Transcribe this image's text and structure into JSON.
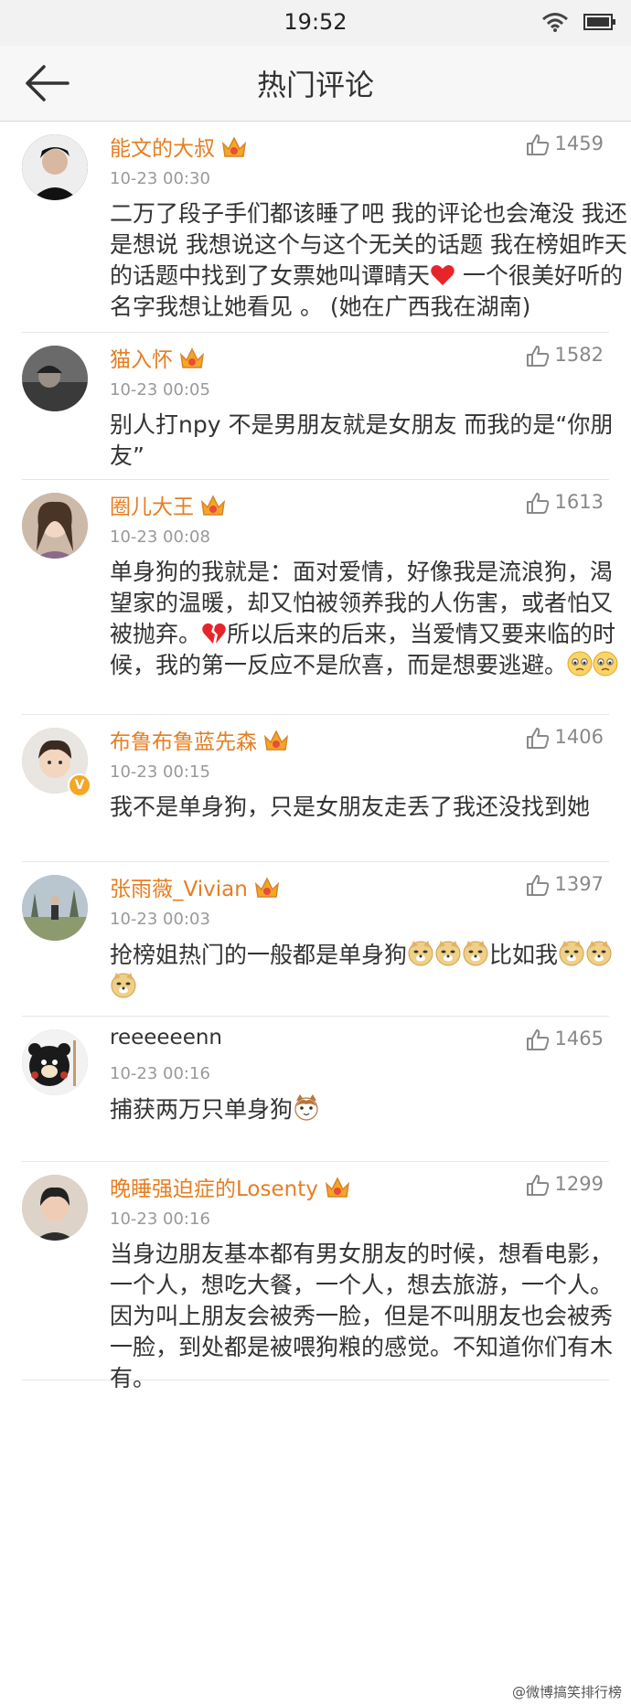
{
  "status": {
    "time": "19:52"
  },
  "header": {
    "title": "热门评论"
  },
  "comments": [
    {
      "user": "能文的大叔",
      "time": "10-23 00:30",
      "likes": "1459",
      "text_a": "二万了段子手们都该睡了吧  我的评论也会淹没  我还是想说  我想说这个与这个无关的话题  我在榜姐昨天的话题中找到了女票她叫谭晴天",
      "text_b": "  一个很美好听的名字我想让她看见 。 (她在广西我在湖南)"
    },
    {
      "user": "猫入怀",
      "time": "10-23 00:05",
      "likes": "1582",
      "text_a": "别人打npy 不是男朋友就是女朋友  而我的是“你朋友”"
    },
    {
      "user": "圈儿大王",
      "time": "10-23 00:08",
      "likes": "1613",
      "text_a": "单身狗的我就是：面对爱情，好像我是流浪狗，渴望家的温暖，却又怕被领养我的人伤害，或者怕又被抛弃。",
      "text_b": "所以后来的后来，当爱情又要来临的时候，我的第一反应不是欣喜，而是想要逃避。"
    },
    {
      "user": "布鲁布鲁蓝先森",
      "time": "10-23 00:15",
      "likes": "1406",
      "text_a": "我不是单身狗，只是女朋友走丢了我还没找到她"
    },
    {
      "user": "张雨薇_Vivian",
      "time": "10-23 00:03",
      "likes": "1397",
      "text_a": "抢榜姐热门的一般都是单身狗",
      "text_b": "比如我"
    },
    {
      "user": "reeeeeenn",
      "time": "10-23 00:16",
      "likes": "1465",
      "text_a": "捕获两万只单身狗"
    },
    {
      "user": "晚睡强迫症的Losenty",
      "time": "10-23 00:16",
      "likes": "1299",
      "text_a": "当身边朋友基本都有男女朋友的时候，想看电影，一个人，想吃大餐，一个人，想去旅游，一个人。因为叫上朋友会被秀一脸，但是不叫朋友也会被秀一脸，到处都是被喂狗粮的感觉。不知道你们有木有。"
    }
  ],
  "footer": {
    "watermark": "@微博搞笑排行榜"
  },
  "colors": {
    "username": "#e67e22",
    "meta": "#999999",
    "text": "#333333"
  }
}
